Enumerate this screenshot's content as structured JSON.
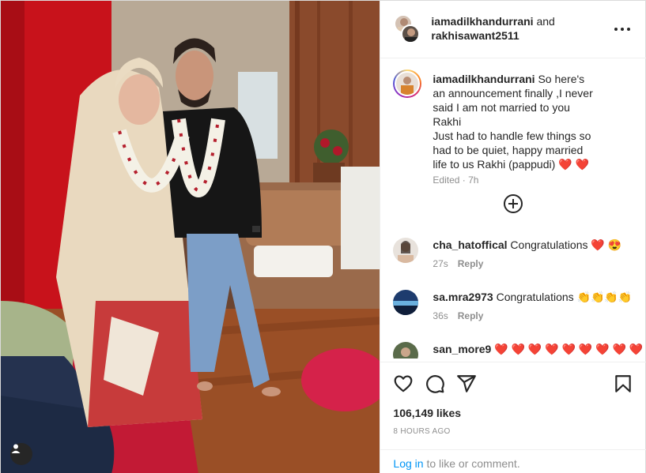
{
  "header": {
    "user1": "iamadilkhandurrani",
    "and_word": "and",
    "user2": "rakhisawant2511"
  },
  "caption": {
    "username": "iamadilkhandurrani",
    "text": " So here's an announcement finally ,I never said I am not married to you Rakhi\nJust had to handle few things so had to be quiet, happy married life to us Rakhi (pappudi) ❤️ ❤️",
    "meta": "Edited · 7h"
  },
  "comments": [
    {
      "username": "cha_hatoffical",
      "text": " Congratulations ❤️ 😍",
      "time": "27s",
      "reply": "Reply"
    },
    {
      "username": "sa.mra2973",
      "text": " Congratulations 👏👏👏👏",
      "time": "36s",
      "reply": "Reply"
    },
    {
      "username": "san_more9",
      "text": " ❤️ ❤️ ❤️ ❤️ ❤️ ❤️ ❤️ ❤️ ❤️",
      "time": "",
      "reply": ""
    }
  ],
  "actions": {
    "icons": [
      "heart-outline-icon",
      "comment-icon",
      "share-icon",
      "bookmark-icon"
    ],
    "likes": "106,149 likes",
    "ago": "8 HOURS AGO"
  },
  "login": {
    "link": "Log in",
    "rest": " to like or comment."
  },
  "colors": {
    "link": "#0095f6",
    "muted": "#8e8e8e",
    "text": "#262626",
    "heart": "#ed4956"
  }
}
